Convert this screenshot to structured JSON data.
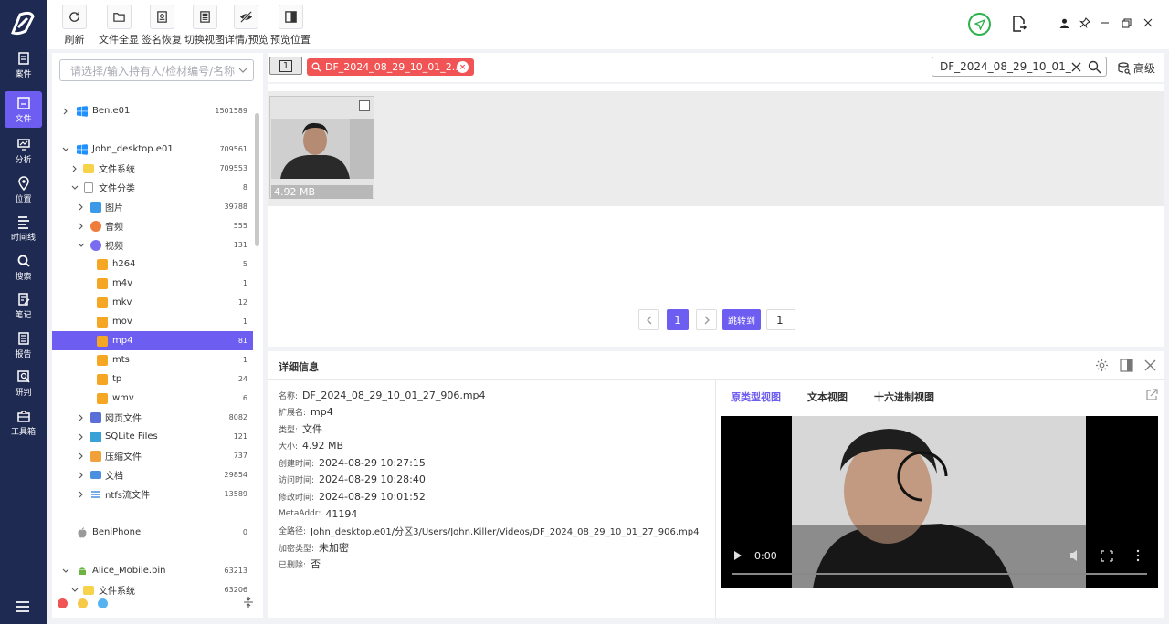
{
  "nav": [
    {
      "label": "案件",
      "icon": "case-icon"
    },
    {
      "label": "文件",
      "icon": "file-icon"
    },
    {
      "label": "分析",
      "icon": "analysis-icon"
    },
    {
      "label": "位置",
      "icon": "location-icon"
    },
    {
      "label": "时间线",
      "icon": "timeline-icon"
    },
    {
      "label": "搜索",
      "icon": "search-icon"
    },
    {
      "label": "笔记",
      "icon": "note-icon"
    },
    {
      "label": "报告",
      "icon": "report-icon"
    },
    {
      "label": "研判",
      "icon": "judge-icon"
    },
    {
      "label": "工具箱",
      "icon": "toolbox-icon"
    }
  ],
  "toolbar": [
    {
      "label": "刷新",
      "icon": "refresh-icon"
    },
    {
      "label": "文件全显",
      "icon": "folder-open-icon"
    },
    {
      "label": "签名恢复",
      "icon": "signature-icon"
    },
    {
      "label": "切换视图",
      "icon": "switch-view-icon"
    },
    {
      "label": "详情/预览",
      "icon": "eye-off-icon"
    },
    {
      "label": "预览位置",
      "icon": "panel-right-icon"
    }
  ],
  "colors": {
    "accent": "#6d5df0",
    "nav_bg": "#1e2a52",
    "tag_red": "#f05454",
    "green": "#2bb24c"
  },
  "sidebar": {
    "search_placeholder": "请选择/输入持有人/检材编号/名称",
    "tree": [
      {
        "label": "Ben.e01",
        "count": "1501589"
      },
      {
        "label": "John_desktop.e01",
        "count": "709561"
      },
      {
        "label": "文件系统",
        "count": "709553"
      },
      {
        "label": "文件分类",
        "count": "8"
      },
      {
        "label": "图片",
        "count": "39788"
      },
      {
        "label": "音频",
        "count": "555"
      },
      {
        "label": "视频",
        "count": "131"
      },
      {
        "label": "h264",
        "count": "5"
      },
      {
        "label": "m4v",
        "count": "1"
      },
      {
        "label": "mkv",
        "count": "12"
      },
      {
        "label": "mov",
        "count": "1"
      },
      {
        "label": "mp4",
        "count": "81"
      },
      {
        "label": "mts",
        "count": "1"
      },
      {
        "label": "tp",
        "count": "24"
      },
      {
        "label": "wmv",
        "count": "6"
      },
      {
        "label": "网页文件",
        "count": "8082"
      },
      {
        "label": "SQLite Files",
        "count": "121"
      },
      {
        "label": "压缩文件",
        "count": "737"
      },
      {
        "label": "文档",
        "count": "29854"
      },
      {
        "label": "ntfs流文件",
        "count": "13589"
      },
      {
        "label": "BeniPhone",
        "count": "0"
      },
      {
        "label": "Alice_Mobile.bin",
        "count": "63213"
      },
      {
        "label": "文件系统",
        "count": "63206"
      }
    ]
  },
  "topbar": {
    "page_indicator": "1",
    "filter_tag": "DF_2024_08_29_10_01_2...",
    "search_value": "DF_2024_08_29_10_01_",
    "advanced_label": "高级"
  },
  "grid": {
    "items": [
      {
        "size": "4.92 MB"
      }
    ]
  },
  "pagination": {
    "current": "1",
    "jump_label": "跳转到",
    "jump_value": "1"
  },
  "detail": {
    "title": "详细信息",
    "fields": [
      {
        "k": "名称:",
        "v": "DF_2024_08_29_10_01_27_906.mp4"
      },
      {
        "k": "扩展名:",
        "v": "mp4"
      },
      {
        "k": "类型:",
        "v": "文件"
      },
      {
        "k": "大小:",
        "v": "4.92 MB"
      },
      {
        "k": "创建时间:",
        "v": "2024-08-29 10:27:15"
      },
      {
        "k": "访问时间:",
        "v": "2024-08-29 10:28:40"
      },
      {
        "k": "修改时间:",
        "v": "2024-08-29 10:01:52"
      },
      {
        "k": "MetaAddr:",
        "v": "41194"
      },
      {
        "k": "全路径:",
        "v": "John_desktop.e01/分区3/Users/John.Killer/Videos/DF_2024_08_29_10_01_27_906.mp4"
      },
      {
        "k": "加密类型:",
        "v": "未加密"
      },
      {
        "k": "已删除:",
        "v": "否"
      }
    ],
    "view_tabs": [
      "原类型视图",
      "文本视图",
      "十六进制视图"
    ],
    "video_time": "0:00"
  }
}
